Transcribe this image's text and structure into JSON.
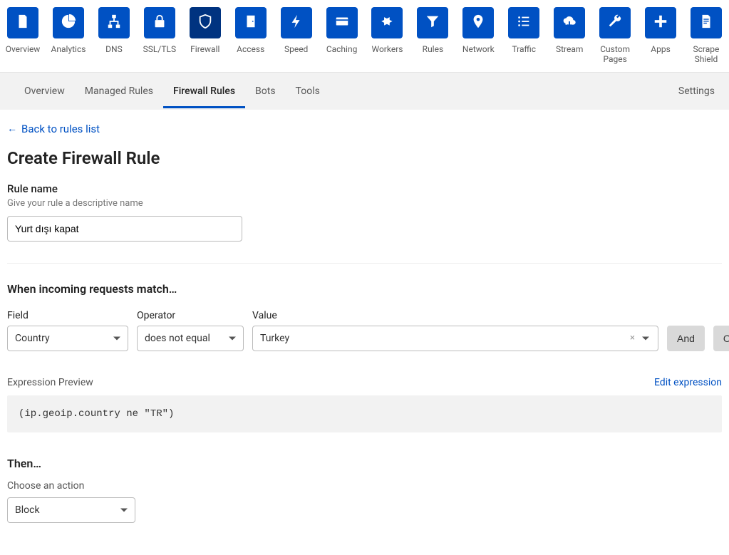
{
  "topnav": {
    "items": [
      {
        "label": "Overview",
        "icon": "clipboard"
      },
      {
        "label": "Analytics",
        "icon": "pie"
      },
      {
        "label": "DNS",
        "icon": "tree"
      },
      {
        "label": "SSL/TLS",
        "icon": "lock"
      },
      {
        "label": "Firewall",
        "icon": "shield",
        "active": true
      },
      {
        "label": "Access",
        "icon": "door"
      },
      {
        "label": "Speed",
        "icon": "bolt"
      },
      {
        "label": "Caching",
        "icon": "card"
      },
      {
        "label": "Workers",
        "icon": "hex"
      },
      {
        "label": "Rules",
        "icon": "funnel"
      },
      {
        "label": "Network",
        "icon": "pin"
      },
      {
        "label": "Traffic",
        "icon": "list"
      },
      {
        "label": "Stream",
        "icon": "cloud"
      },
      {
        "label": "Custom Pages",
        "icon": "wrench"
      },
      {
        "label": "Apps",
        "icon": "plus"
      },
      {
        "label": "Scrape Shield",
        "icon": "doc"
      }
    ]
  },
  "subnav": {
    "items": [
      {
        "label": "Overview"
      },
      {
        "label": "Managed Rules"
      },
      {
        "label": "Firewall Rules",
        "active": true
      },
      {
        "label": "Bots"
      },
      {
        "label": "Tools"
      }
    ],
    "settings": "Settings"
  },
  "backlink": "Back to rules list",
  "page_title": "Create Firewall Rule",
  "rule_name": {
    "label": "Rule name",
    "help": "Give your rule a descriptive name",
    "value": "Yurt dışı kapat"
  },
  "match": {
    "heading": "When incoming requests match…",
    "field_label": "Field",
    "operator_label": "Operator",
    "value_label": "Value",
    "field_value": "Country",
    "operator_value": "does not equal",
    "value_value": "Turkey",
    "and_label": "And",
    "or_label": "Or"
  },
  "preview": {
    "label": "Expression Preview",
    "edit": "Edit expression",
    "expression": "(ip.geoip.country ne \"TR\")"
  },
  "then": {
    "heading": "Then…",
    "action_label": "Choose an action",
    "action_value": "Block"
  }
}
